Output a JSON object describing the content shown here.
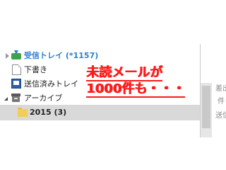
{
  "folders": [
    {
      "label": "受信トレイ (*1157)",
      "icon": "inbox-icon",
      "expander": "collapsed",
      "unread_color": "#2c7fd4"
    },
    {
      "label": "下書き",
      "icon": "draft-icon"
    },
    {
      "label": "送信済みトレイ",
      "icon": "sent-icon"
    },
    {
      "label": "アーカイブ",
      "icon": "archive-icon",
      "expander": "expanded"
    },
    {
      "label": "2015 (3)",
      "icon": "folder-icon",
      "selected": true
    }
  ],
  "reading_pane": {
    "lines": [
      "差出",
      "件",
      "送信"
    ]
  },
  "annotation": {
    "line1": "未読メールが",
    "line2": "1000件も・・・",
    "color": "#ff1a1a"
  }
}
